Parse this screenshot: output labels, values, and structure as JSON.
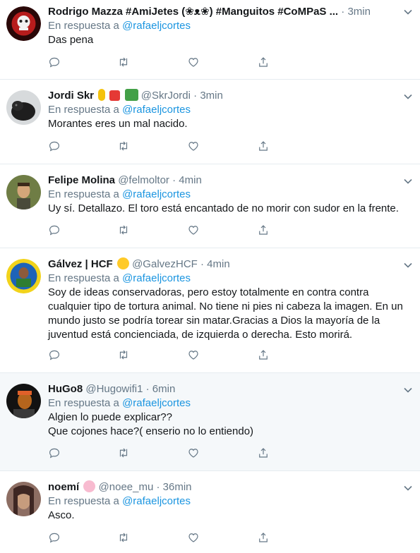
{
  "reply_prefix": "En respuesta a",
  "tweets": [
    {
      "name": "Rodrigo Mazza #AmiJetes (❀ᴥ❀) #Manguitos #CoMPaS ...",
      "handle": "",
      "separator": "·",
      "time": "3min",
      "reply_to": "@rafaeljcortes",
      "lines": [
        "Das pena"
      ],
      "avatar_colors": [
        "#3a0a0a",
        "#c62828",
        "#f5f5f5"
      ],
      "shaded": false
    },
    {
      "name": "Jordi Skr",
      "handle": "@SkrJordi",
      "separator": "·",
      "time": "3min",
      "reply_to": "@rafaeljcortes",
      "lines": [
        "Morantes eres un mal nacido."
      ],
      "avatar_colors": [
        "#cfd3d6",
        "#1a1a1a",
        "#2b2b2b"
      ],
      "emojis": [
        "ribbon-icon",
        "swiss-flag-icon",
        "money-icon"
      ],
      "shaded": false
    },
    {
      "name": "Felipe Molina",
      "handle": "@felmoltor",
      "separator": "·",
      "time": "4min",
      "reply_to": "@rafaeljcortes",
      "lines": [
        "Uy sí. Detallazo. El toro está encantado de no morir con sudor en la frente."
      ],
      "avatar_colors": [
        "#7a8a4a",
        "#c8a070",
        "#3b3b2b"
      ],
      "shaded": false
    },
    {
      "name": "Gálvez | HCF",
      "handle": "@GalvezHCF",
      "separator": "·",
      "time": "4min",
      "reply_to": "@rafaeljcortes",
      "lines": [
        "Soy de ideas conservadoras, pero estoy totalmente en contra contra",
        "cualquier tipo de tortura animal. No tiene ni pies ni cabeza la imagen. En un",
        "mundo justo se podría torear sin matar.Gracias a Dios la mayoría de la",
        "juventud está concienciada, de izquierda o derecha. Esto morirá."
      ],
      "avatar_colors": [
        "#f2d31b",
        "#1565c0",
        "#2e7d32"
      ],
      "emojis": [
        "shush-face-icon"
      ],
      "shaded": false
    },
    {
      "name": "HuGo8",
      "handle": "@Hugowifi1",
      "separator": "·",
      "time": "6min",
      "reply_to": "@rafaeljcortes",
      "lines": [
        "Algien lo puede explicar??",
        "Que cojones hace?( enserio no lo entiendo)"
      ],
      "avatar_colors": [
        "#111111",
        "#d2691e",
        "#b5651d"
      ],
      "shaded": true
    },
    {
      "name": "noemí",
      "handle": "@noee_mu",
      "separator": "·",
      "time": "36min",
      "reply_to": "@rafaeljcortes",
      "lines": [
        "Asco."
      ],
      "avatar_colors": [
        "#6d4c41",
        "#3e2723",
        "#a1887f"
      ],
      "emojis": [
        "cherry-blossom-icon"
      ],
      "shaded": false
    }
  ]
}
